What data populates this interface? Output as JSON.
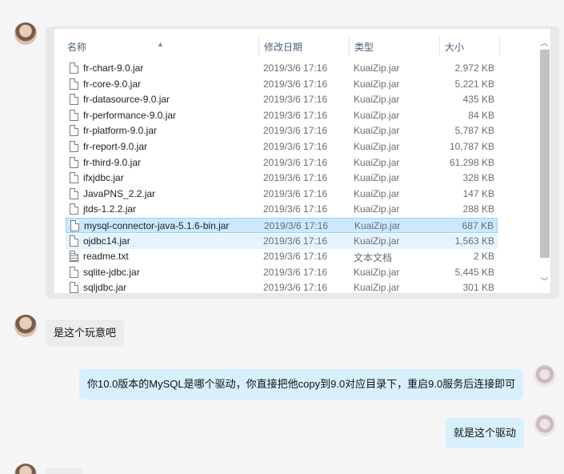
{
  "explorer": {
    "columns": {
      "name": "名称",
      "date": "修改日期",
      "type": "类型",
      "size": "大小"
    },
    "files": [
      {
        "name": "fr-chart-9.0.jar",
        "date": "2019/3/6 17:16",
        "type": "KuaiZip.jar",
        "size": "2,972 KB",
        "kind": "jar"
      },
      {
        "name": "fr-core-9.0.jar",
        "date": "2019/3/6 17:16",
        "type": "KuaiZip.jar",
        "size": "5,221 KB",
        "kind": "jar"
      },
      {
        "name": "fr-datasource-9.0.jar",
        "date": "2019/3/6 17:16",
        "type": "KuaiZip.jar",
        "size": "435 KB",
        "kind": "jar"
      },
      {
        "name": "fr-performance-9.0.jar",
        "date": "2019/3/6 17:16",
        "type": "KuaiZip.jar",
        "size": "84 KB",
        "kind": "jar"
      },
      {
        "name": "fr-platform-9.0.jar",
        "date": "2019/3/6 17:16",
        "type": "KuaiZip.jar",
        "size": "5,787 KB",
        "kind": "jar"
      },
      {
        "name": "fr-report-9.0.jar",
        "date": "2019/3/6 17:16",
        "type": "KuaiZip.jar",
        "size": "10,787 KB",
        "kind": "jar"
      },
      {
        "name": "fr-third-9.0.jar",
        "date": "2019/3/6 17:16",
        "type": "KuaiZip.jar",
        "size": "61,298 KB",
        "kind": "jar"
      },
      {
        "name": "ifxjdbc.jar",
        "date": "2019/3/6 17:16",
        "type": "KuaiZip.jar",
        "size": "328 KB",
        "kind": "jar"
      },
      {
        "name": "JavaPNS_2.2.jar",
        "date": "2019/3/6 17:16",
        "type": "KuaiZip.jar",
        "size": "147 KB",
        "kind": "jar"
      },
      {
        "name": "jtds-1.2.2.jar",
        "date": "2019/3/6 17:16",
        "type": "KuaiZip.jar",
        "size": "288 KB",
        "kind": "jar"
      },
      {
        "name": "mysql-connector-java-5.1.6-bin.jar",
        "date": "2019/3/6 17:16",
        "type": "KuaiZip.jar",
        "size": "687 KB",
        "kind": "jar",
        "state": "selected"
      },
      {
        "name": "ojdbc14.jar",
        "date": "2019/3/6 17:16",
        "type": "KuaiZip.jar",
        "size": "1,563 KB",
        "kind": "jar",
        "state": "hover"
      },
      {
        "name": "readme.txt",
        "date": "2019/3/6 17:16",
        "type": "文本文档",
        "size": "2 KB",
        "kind": "txt"
      },
      {
        "name": "sqlite-jdbc.jar",
        "date": "2019/3/6 17:16",
        "type": "KuaiZip.jar",
        "size": "5,445 KB",
        "kind": "jar"
      },
      {
        "name": "sqljdbc.jar",
        "date": "2019/3/6 17:16",
        "type": "KuaiZip.jar",
        "size": "301 KB",
        "kind": "jar"
      }
    ]
  },
  "messages": [
    {
      "side": "left",
      "text": "是这个玩意吧"
    },
    {
      "side": "right",
      "text": "你10.0版本的MySQL是哪个驱动，你直接把他copy到9.0对应目录下，重启9.0服务后连接即可"
    },
    {
      "side": "right",
      "text": "就是这个驱动"
    },
    {
      "side": "left",
      "text": ""
    }
  ],
  "colors": {
    "selected_row": "#cce8ff",
    "hover_row": "#e5f3ff",
    "right_bubble": "#d7f0fb",
    "left_bubble": "#ececec",
    "header_text": "#4c607a"
  },
  "icons": {
    "file": "file-icon",
    "text_file": "text-file-icon",
    "scroll_up": "chevron-up-icon",
    "scroll_down": "chevron-down-icon",
    "sort": "sort-ascending-icon"
  }
}
